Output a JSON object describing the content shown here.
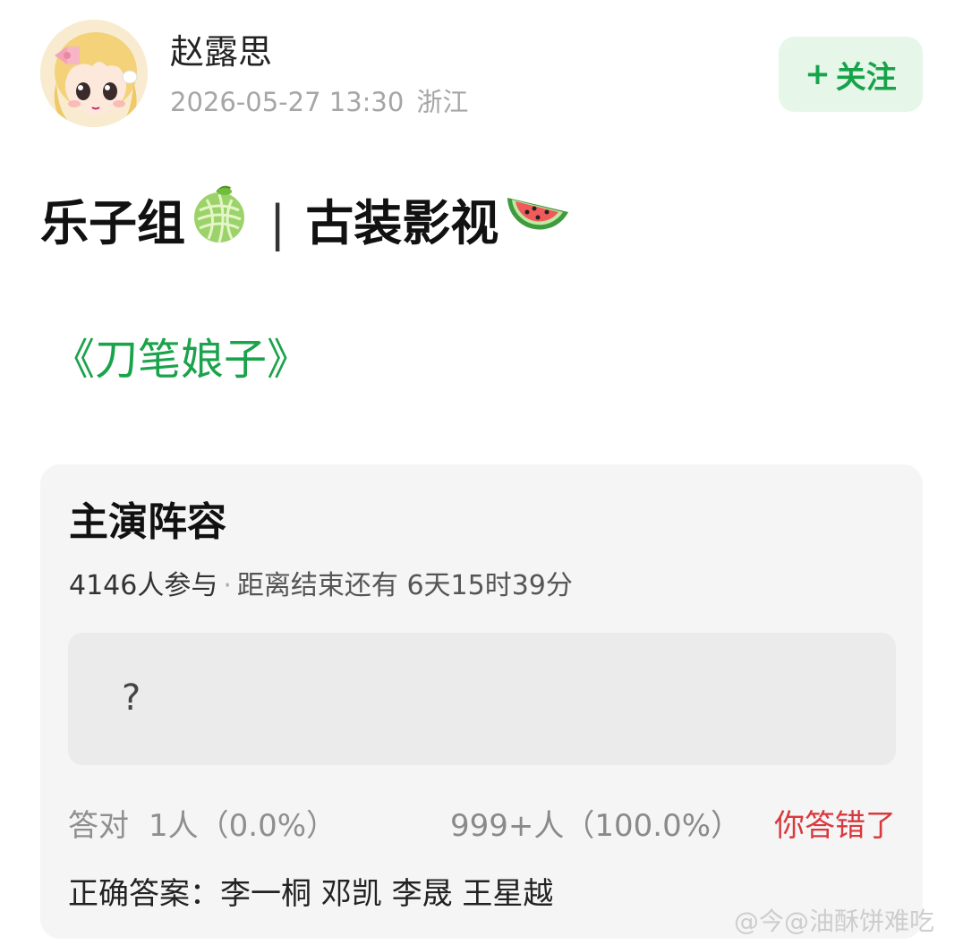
{
  "post": {
    "author": "赵露思",
    "timestamp": "2026-05-27 13:30",
    "location": "浙江",
    "follow_label": "关注",
    "follow_plus": "+",
    "title_part1": "乐子组",
    "title_separator": "|",
    "title_part2": "古装影视",
    "title_emoji_1": "melon-emoji",
    "title_emoji_2": "watermelon-emoji",
    "topic": "《刀笔娘子》"
  },
  "quiz": {
    "title": "主演阵容",
    "participants": "4146人参与",
    "dot": "·",
    "remaining": "距离结束还有 6天15时39分",
    "option_text": "?",
    "correct_label": "答对",
    "correct_count": "1人（0.0%）",
    "other_count": "999+人（100.0%）",
    "wrong_notice": "你答错了",
    "answer_label": "正确答案：",
    "answer_value": "李一桐 邓凯 李晟 王星越"
  },
  "watermark": {
    "text": "@今@油酥饼难吃"
  },
  "colors": {
    "accent_green": "#16a34a",
    "follow_bg": "#e6f6e9",
    "wrong_red": "#d9393e",
    "card_bg": "#f5f5f5"
  }
}
